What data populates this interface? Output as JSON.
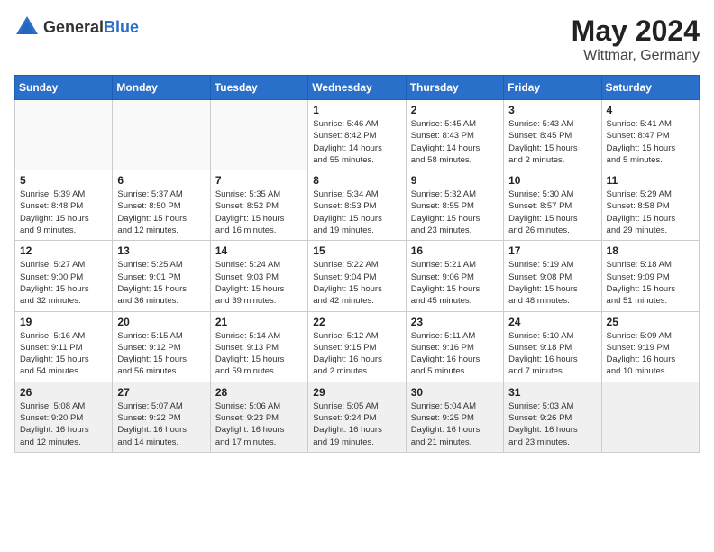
{
  "header": {
    "logo_general": "General",
    "logo_blue": "Blue",
    "month_year": "May 2024",
    "location": "Wittmar, Germany"
  },
  "weekdays": [
    "Sunday",
    "Monday",
    "Tuesday",
    "Wednesday",
    "Thursday",
    "Friday",
    "Saturday"
  ],
  "weeks": [
    [
      {
        "day": "",
        "info": ""
      },
      {
        "day": "",
        "info": ""
      },
      {
        "day": "",
        "info": ""
      },
      {
        "day": "1",
        "info": "Sunrise: 5:46 AM\nSunset: 8:42 PM\nDaylight: 14 hours\nand 55 minutes."
      },
      {
        "day": "2",
        "info": "Sunrise: 5:45 AM\nSunset: 8:43 PM\nDaylight: 14 hours\nand 58 minutes."
      },
      {
        "day": "3",
        "info": "Sunrise: 5:43 AM\nSunset: 8:45 PM\nDaylight: 15 hours\nand 2 minutes."
      },
      {
        "day": "4",
        "info": "Sunrise: 5:41 AM\nSunset: 8:47 PM\nDaylight: 15 hours\nand 5 minutes."
      }
    ],
    [
      {
        "day": "5",
        "info": "Sunrise: 5:39 AM\nSunset: 8:48 PM\nDaylight: 15 hours\nand 9 minutes."
      },
      {
        "day": "6",
        "info": "Sunrise: 5:37 AM\nSunset: 8:50 PM\nDaylight: 15 hours\nand 12 minutes."
      },
      {
        "day": "7",
        "info": "Sunrise: 5:35 AM\nSunset: 8:52 PM\nDaylight: 15 hours\nand 16 minutes."
      },
      {
        "day": "8",
        "info": "Sunrise: 5:34 AM\nSunset: 8:53 PM\nDaylight: 15 hours\nand 19 minutes."
      },
      {
        "day": "9",
        "info": "Sunrise: 5:32 AM\nSunset: 8:55 PM\nDaylight: 15 hours\nand 23 minutes."
      },
      {
        "day": "10",
        "info": "Sunrise: 5:30 AM\nSunset: 8:57 PM\nDaylight: 15 hours\nand 26 minutes."
      },
      {
        "day": "11",
        "info": "Sunrise: 5:29 AM\nSunset: 8:58 PM\nDaylight: 15 hours\nand 29 minutes."
      }
    ],
    [
      {
        "day": "12",
        "info": "Sunrise: 5:27 AM\nSunset: 9:00 PM\nDaylight: 15 hours\nand 32 minutes."
      },
      {
        "day": "13",
        "info": "Sunrise: 5:25 AM\nSunset: 9:01 PM\nDaylight: 15 hours\nand 36 minutes."
      },
      {
        "day": "14",
        "info": "Sunrise: 5:24 AM\nSunset: 9:03 PM\nDaylight: 15 hours\nand 39 minutes."
      },
      {
        "day": "15",
        "info": "Sunrise: 5:22 AM\nSunset: 9:04 PM\nDaylight: 15 hours\nand 42 minutes."
      },
      {
        "day": "16",
        "info": "Sunrise: 5:21 AM\nSunset: 9:06 PM\nDaylight: 15 hours\nand 45 minutes."
      },
      {
        "day": "17",
        "info": "Sunrise: 5:19 AM\nSunset: 9:08 PM\nDaylight: 15 hours\nand 48 minutes."
      },
      {
        "day": "18",
        "info": "Sunrise: 5:18 AM\nSunset: 9:09 PM\nDaylight: 15 hours\nand 51 minutes."
      }
    ],
    [
      {
        "day": "19",
        "info": "Sunrise: 5:16 AM\nSunset: 9:11 PM\nDaylight: 15 hours\nand 54 minutes."
      },
      {
        "day": "20",
        "info": "Sunrise: 5:15 AM\nSunset: 9:12 PM\nDaylight: 15 hours\nand 56 minutes."
      },
      {
        "day": "21",
        "info": "Sunrise: 5:14 AM\nSunset: 9:13 PM\nDaylight: 15 hours\nand 59 minutes."
      },
      {
        "day": "22",
        "info": "Sunrise: 5:12 AM\nSunset: 9:15 PM\nDaylight: 16 hours\nand 2 minutes."
      },
      {
        "day": "23",
        "info": "Sunrise: 5:11 AM\nSunset: 9:16 PM\nDaylight: 16 hours\nand 5 minutes."
      },
      {
        "day": "24",
        "info": "Sunrise: 5:10 AM\nSunset: 9:18 PM\nDaylight: 16 hours\nand 7 minutes."
      },
      {
        "day": "25",
        "info": "Sunrise: 5:09 AM\nSunset: 9:19 PM\nDaylight: 16 hours\nand 10 minutes."
      }
    ],
    [
      {
        "day": "26",
        "info": "Sunrise: 5:08 AM\nSunset: 9:20 PM\nDaylight: 16 hours\nand 12 minutes."
      },
      {
        "day": "27",
        "info": "Sunrise: 5:07 AM\nSunset: 9:22 PM\nDaylight: 16 hours\nand 14 minutes."
      },
      {
        "day": "28",
        "info": "Sunrise: 5:06 AM\nSunset: 9:23 PM\nDaylight: 16 hours\nand 17 minutes."
      },
      {
        "day": "29",
        "info": "Sunrise: 5:05 AM\nSunset: 9:24 PM\nDaylight: 16 hours\nand 19 minutes."
      },
      {
        "day": "30",
        "info": "Sunrise: 5:04 AM\nSunset: 9:25 PM\nDaylight: 16 hours\nand 21 minutes."
      },
      {
        "day": "31",
        "info": "Sunrise: 5:03 AM\nSunset: 9:26 PM\nDaylight: 16 hours\nand 23 minutes."
      },
      {
        "day": "",
        "info": ""
      }
    ]
  ]
}
